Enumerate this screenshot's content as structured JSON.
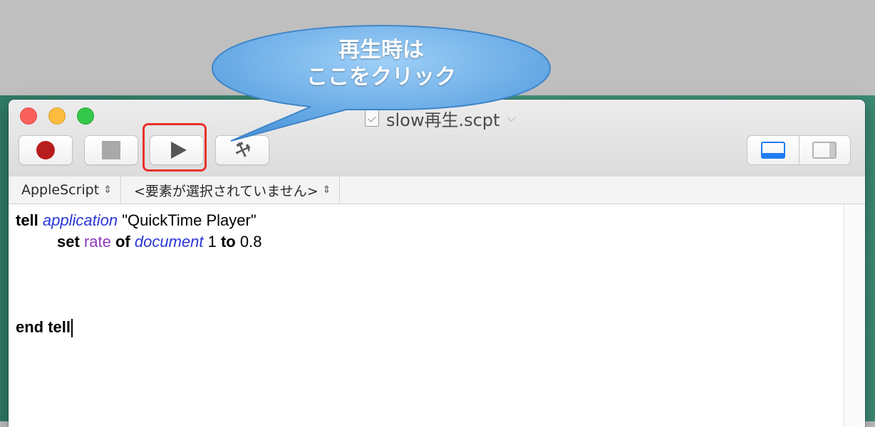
{
  "callout": {
    "line1": "再生時は",
    "line2": "ここをクリック"
  },
  "window": {
    "title": "slow再生.scpt",
    "title_chevron": "⌵",
    "traffic_lights": [
      "close",
      "minimize",
      "zoom"
    ]
  },
  "toolbar": {
    "buttons": [
      {
        "name": "record-button",
        "icon": "record-icon"
      },
      {
        "name": "stop-button",
        "icon": "stop-icon"
      },
      {
        "name": "run-button",
        "icon": "play-icon",
        "highlighted": true
      },
      {
        "name": "compile-button",
        "icon": "hammer-icon"
      }
    ],
    "view_toggle": [
      "bottom-view",
      "side-view"
    ]
  },
  "navbar": {
    "language": "AppleScript",
    "element": "<要素が選択されていません>",
    "updown_glyph": "⇕"
  },
  "script": {
    "line1": {
      "kw": "tell",
      "app": "application",
      "str": "\"QuickTime Player\""
    },
    "line2": {
      "kw_set": "set",
      "prop": "rate",
      "kw_of": "of",
      "app": "document",
      "num": "1",
      "kw_to": "to",
      "val": "0.8"
    },
    "line6": {
      "kw": "end tell"
    }
  },
  "colors": {
    "keyword": "#000000",
    "application": "#2a36d8",
    "property": "#8a3ab9",
    "highlight": "#e8312a",
    "callout": "#5aa6e6"
  }
}
